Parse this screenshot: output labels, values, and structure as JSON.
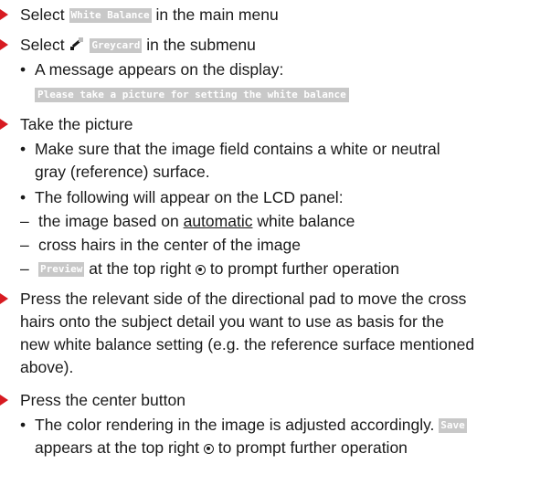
{
  "steps": [
    {
      "prefix": "Select ",
      "chip": "White Balance",
      "suffix": " in the main menu"
    },
    {
      "prefix": "Select ",
      "icon": "greycard-wb-icon",
      "chip": "Greycard",
      "suffix": " in the submenu",
      "bullets": [
        {
          "text": "A message appears on the display:",
          "chip": "Please take a picture for setting the white balance"
        }
      ]
    },
    {
      "text": "Take the picture",
      "bullets": [
        {
          "lines": [
            "Make sure that the image field contains a white or neutral",
            "gray (reference) surface."
          ]
        },
        {
          "text": "The following will appear on the LCD panel:",
          "dashes": [
            {
              "prefix": "the image based on ",
              "underline": "automatic",
              "suffix": " white balance"
            },
            {
              "text": "cross hairs in the center of the image"
            },
            {
              "chip": "Preview",
              "suffix_a": " at the top right ",
              "icon": "center-button-icon",
              "suffix_b": " to prompt further operation"
            }
          ]
        }
      ]
    },
    {
      "lines": [
        "Press the relevant side of the directional pad to move the cross",
        "hairs onto the subject detail you want to use as basis for the",
        "new white balance setting (e.g. the reference surface mentioned",
        "above)."
      ]
    },
    {
      "text": "Press the center button",
      "bullets": [
        {
          "line1": "The color rendering in the image is adjusted accordingly.",
          "chip": "Save",
          "line2_prefix": "appears at the top right ",
          "icon": "center-button-icon",
          "line2_suffix": " to prompt further operation"
        }
      ]
    }
  ],
  "colors": {
    "arrow": "#d71a21",
    "chip_bg": "#c8c8c8",
    "text": "#1a1a1a"
  }
}
